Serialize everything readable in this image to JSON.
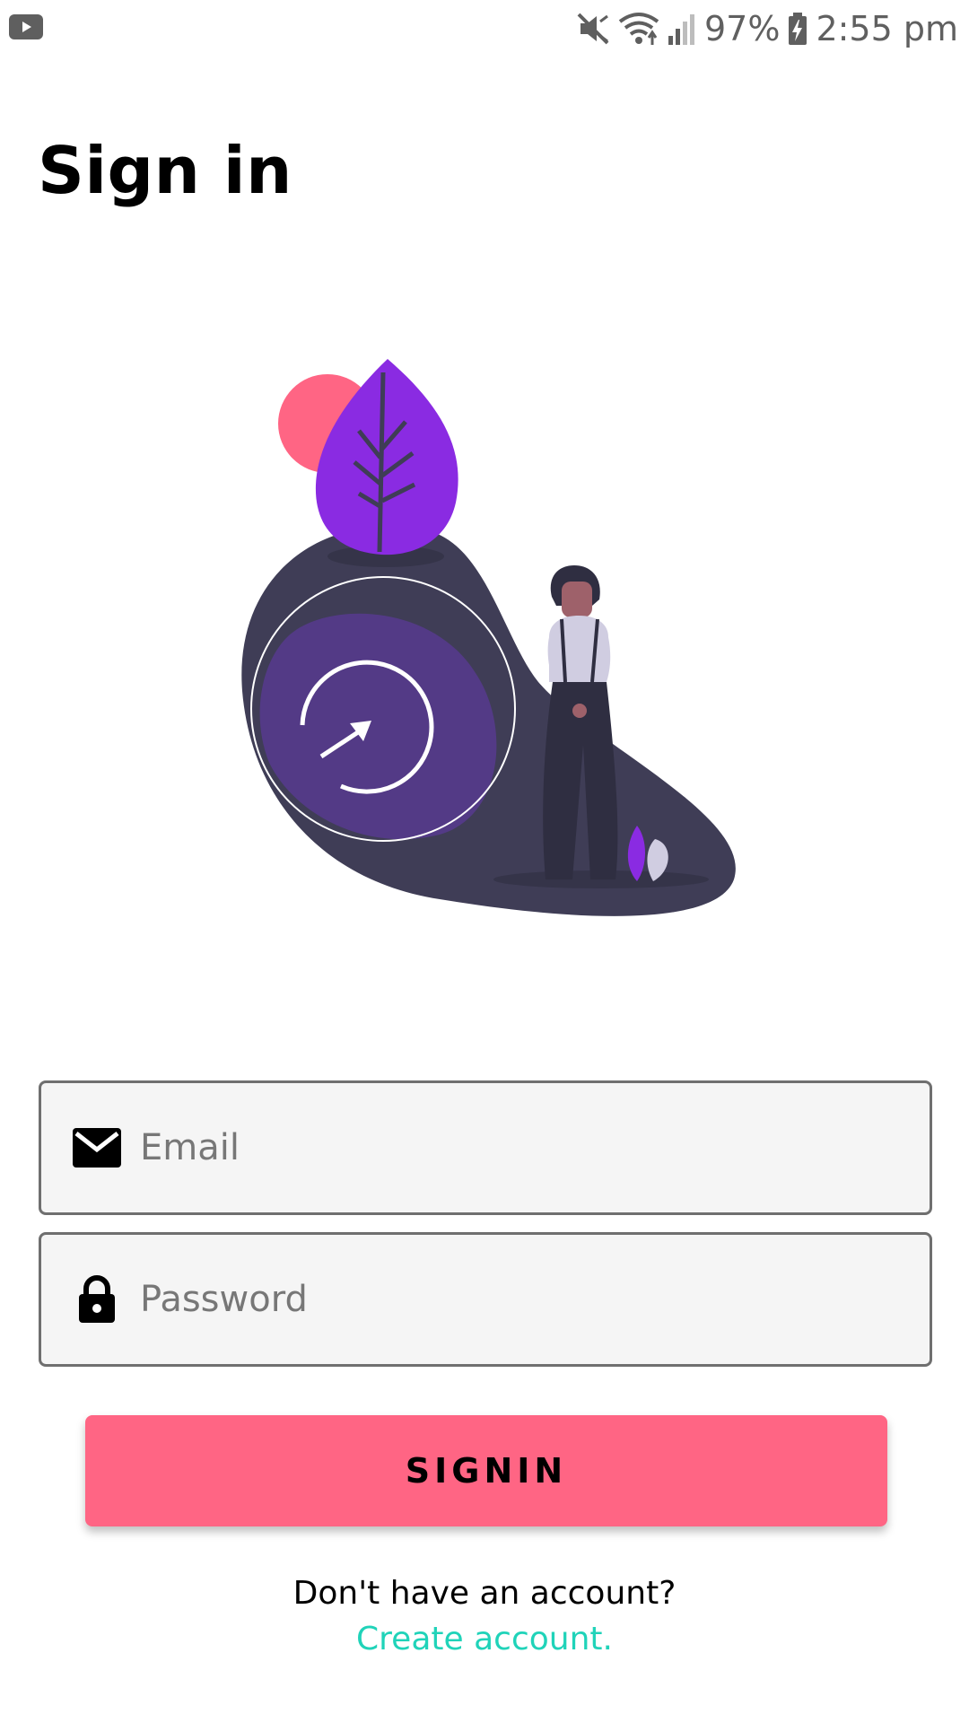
{
  "status_bar": {
    "left_icon": "youtube-icon",
    "icons": [
      "mute-icon",
      "wifi-icon",
      "signal-icon",
      "battery-charging-icon"
    ],
    "battery": "97%",
    "time": "2:55 pm"
  },
  "page": {
    "title": "Sign in"
  },
  "illustration": {
    "description_icon": "sign-in-illustration",
    "colors": {
      "blob": "#3f3d56",
      "circle": "#533a86",
      "leaf": "#8a2be2",
      "sun": "#ff6584"
    }
  },
  "form": {
    "email": {
      "icon": "mail-icon",
      "placeholder": "Email",
      "value": ""
    },
    "password": {
      "icon": "lock-icon",
      "placeholder": "Password",
      "value": ""
    },
    "signin_label": "SIGNIN"
  },
  "footer": {
    "prompt": "Don't have an account?",
    "link": "Create account."
  },
  "colors": {
    "accent": "#ff6584",
    "link": "#20d3b9",
    "field_bg": "#f5f5f5",
    "field_border": "#6f6f6f"
  }
}
